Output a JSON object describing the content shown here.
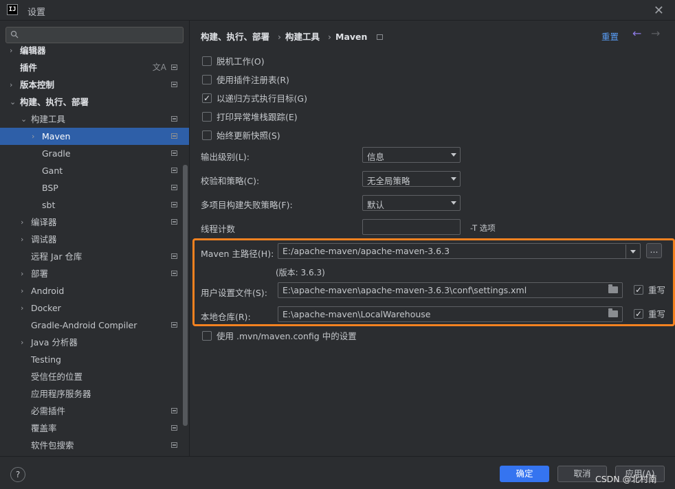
{
  "window": {
    "title": "设置",
    "logo": "IJ"
  },
  "search": {
    "placeholder": ""
  },
  "sidebar": {
    "items": [
      {
        "label": "编辑器",
        "level": 0,
        "chevron": "›",
        "bold": true,
        "scope": false
      },
      {
        "label": "插件",
        "level": 0,
        "chevron": "",
        "bold": true,
        "scope": true,
        "lang": true
      },
      {
        "label": "版本控制",
        "level": 0,
        "chevron": "›",
        "bold": true,
        "scope": true
      },
      {
        "label": "构建、执行、部署",
        "level": 0,
        "chevron": "⌄",
        "bold": true,
        "scope": false
      },
      {
        "label": "构建工具",
        "level": 1,
        "chevron": "⌄",
        "bold": false,
        "scope": true
      },
      {
        "label": "Maven",
        "level": 2,
        "chevron": "›",
        "bold": false,
        "scope": true,
        "selected": true
      },
      {
        "label": "Gradle",
        "level": 2,
        "chevron": "",
        "bold": false,
        "scope": true
      },
      {
        "label": "Gant",
        "level": 2,
        "chevron": "",
        "bold": false,
        "scope": true
      },
      {
        "label": "BSP",
        "level": 2,
        "chevron": "",
        "bold": false,
        "scope": true
      },
      {
        "label": "sbt",
        "level": 2,
        "chevron": "",
        "bold": false,
        "scope": true
      },
      {
        "label": "编译器",
        "level": 1,
        "chevron": "›",
        "bold": false,
        "scope": true
      },
      {
        "label": "调试器",
        "level": 1,
        "chevron": "›",
        "bold": false,
        "scope": false
      },
      {
        "label": "远程 Jar 仓库",
        "level": 1,
        "chevron": "",
        "bold": false,
        "scope": true
      },
      {
        "label": "部署",
        "level": 1,
        "chevron": "›",
        "bold": false,
        "scope": true
      },
      {
        "label": "Android",
        "level": 1,
        "chevron": "›",
        "bold": false,
        "scope": false
      },
      {
        "label": "Docker",
        "level": 1,
        "chevron": "›",
        "bold": false,
        "scope": false
      },
      {
        "label": "Gradle-Android Compiler",
        "level": 1,
        "chevron": "",
        "bold": false,
        "scope": true
      },
      {
        "label": "Java 分析器",
        "level": 1,
        "chevron": "›",
        "bold": false,
        "scope": false
      },
      {
        "label": "Testing",
        "level": 1,
        "chevron": "",
        "bold": false,
        "scope": false
      },
      {
        "label": "受信任的位置",
        "level": 1,
        "chevron": "",
        "bold": false,
        "scope": false
      },
      {
        "label": "应用程序服务器",
        "level": 1,
        "chevron": "",
        "bold": false,
        "scope": false
      },
      {
        "label": "必需插件",
        "level": 1,
        "chevron": "",
        "bold": false,
        "scope": true
      },
      {
        "label": "覆盖率",
        "level": 1,
        "chevron": "",
        "bold": false,
        "scope": true
      },
      {
        "label": "软件包搜索",
        "level": 1,
        "chevron": "",
        "bold": false,
        "scope": true
      }
    ]
  },
  "breadcrumb": {
    "part1": "构建、执行、部署",
    "part2": "构建工具",
    "part3": "Maven",
    "sep": "›"
  },
  "header": {
    "reset": "重置",
    "back": "←",
    "forward": "→"
  },
  "checkboxes": [
    {
      "label": "脱机工作(O)",
      "checked": false
    },
    {
      "label": "使用插件注册表(R)",
      "checked": false
    },
    {
      "label": "以递归方式执行目标(G)",
      "checked": true
    },
    {
      "label": "打印异常堆栈跟踪(E)",
      "checked": false
    },
    {
      "label": "始终更新快照(S)",
      "checked": false
    }
  ],
  "fields": {
    "output_level": {
      "label": "输出级别(L):",
      "value": "信息"
    },
    "checksum_policy": {
      "label": "校验和策略(C):",
      "value": "无全局策略"
    },
    "multiproject_fail": {
      "label": "多项目构建失败策略(F):",
      "value": "默认"
    },
    "thread_count": {
      "label": "线程计数",
      "value": "",
      "hint": "-T 选项"
    }
  },
  "maven": {
    "home_label": "Maven 主路径(H):",
    "home_value": "E:/apache-maven/apache-maven-3.6.3",
    "browse": "...",
    "version": "(版本: 3.6.3)",
    "settings_label": "用户设置文件(S):",
    "settings_value": "E:\\apache-maven\\apache-maven-3.6.3\\conf\\settings.xml",
    "settings_override": "重写",
    "repo_label": "本地仓库(R):",
    "repo_value": "E:\\apache-maven\\LocalWarehouse",
    "repo_override": "重写"
  },
  "mvn_config": {
    "label": "使用 .mvn/maven.config 中的设置",
    "checked": false
  },
  "footer": {
    "help": "?",
    "ok": "确定",
    "cancel": "取消",
    "apply": "应用(A)",
    "watermark": "CSDN @北村南"
  },
  "colors": {
    "accent": "#3574f0",
    "selection": "#2e5fa8",
    "highlight": "#f58220",
    "link": "#589df6"
  }
}
